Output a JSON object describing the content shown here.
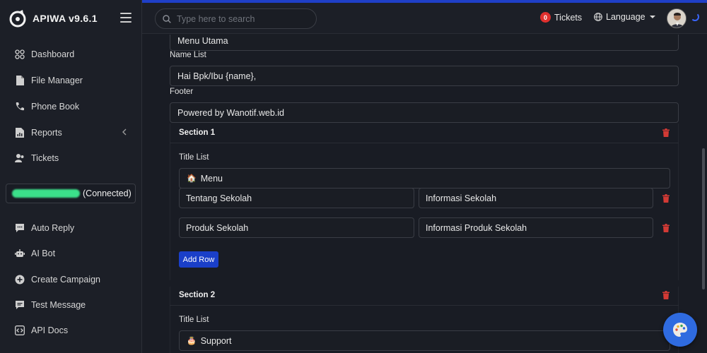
{
  "app": {
    "name": "APIWA v9.6.1"
  },
  "sidebar": {
    "items": [
      {
        "label": "Dashboard",
        "icon": "dashboard-icon"
      },
      {
        "label": "File Manager",
        "icon": "file-icon"
      },
      {
        "label": "Phone Book",
        "icon": "phone-icon"
      },
      {
        "label": "Reports",
        "icon": "reports-icon"
      },
      {
        "label": "Tickets",
        "icon": "tickets-icon"
      }
    ],
    "device": {
      "status": "(Connected)"
    },
    "items2": [
      {
        "label": "Auto Reply",
        "icon": "chat-icon"
      },
      {
        "label": "AI Bot",
        "icon": "robot-icon"
      },
      {
        "label": "Create Campaign",
        "icon": "plus-circle-icon"
      },
      {
        "label": "Test Message",
        "icon": "message-icon"
      },
      {
        "label": "API Docs",
        "icon": "code-icon"
      }
    ]
  },
  "topbar": {
    "search_placeholder": "Type here to search",
    "tickets_count": "0",
    "tickets_label": "Tickets",
    "language_label": "Language"
  },
  "form": {
    "menu_value": "Menu Utama",
    "name_list_label": "Name List",
    "name_list_value": "Hai Bpk/Ibu {name},",
    "footer_label": "Footer",
    "footer_value": "Powered by Wanotif.web.id"
  },
  "sections": [
    {
      "title": "Section 1",
      "title_list_label": "Title List",
      "title_list_icon": "🏠",
      "title_list_value": "Menu",
      "rows": [
        {
          "title": "Tentang Sekolah",
          "description": "Informasi Sekolah"
        },
        {
          "title": "Produk Sekolah",
          "description": "Informasi Produk Sekolah"
        }
      ],
      "add_row_label": "Add Row"
    },
    {
      "title": "Section 2",
      "title_list_label": "Title List",
      "title_list_icon": "🎂",
      "title_list_value": "Support"
    }
  ],
  "colors": {
    "accent": "#1a3fc9",
    "danger": "#e0302e",
    "fab": "#2f6be0"
  }
}
